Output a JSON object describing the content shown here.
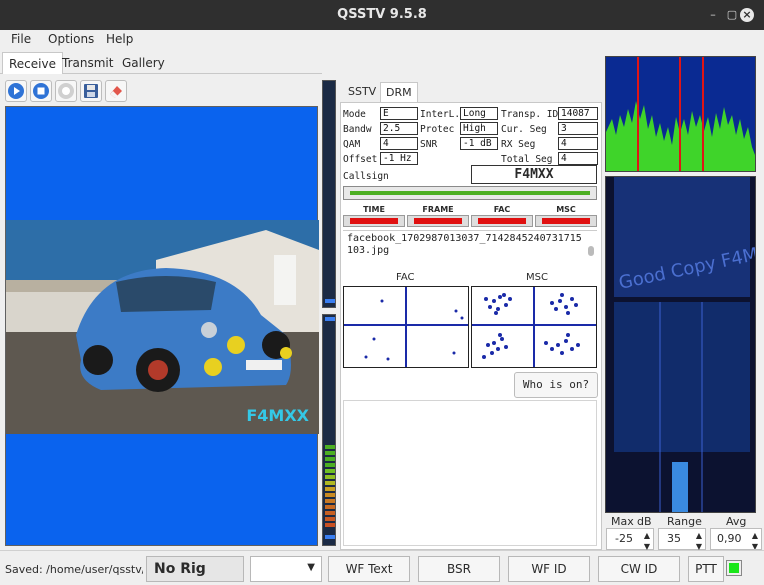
{
  "window": {
    "title": "QSSTV 9.5.8"
  },
  "menu": {
    "items": [
      "File",
      "Options",
      "Help"
    ]
  },
  "tabs": [
    "Receive",
    "Transmit",
    "Gallery"
  ],
  "toolbar": {
    "icons": [
      "start-icon",
      "stop-icon",
      "erase-icon",
      "save-icon",
      "eraser-icon"
    ]
  },
  "image": {
    "callsign_overlay": "F4MXX"
  },
  "mode_tabs": [
    "SSTV",
    "DRM"
  ],
  "drm": {
    "mode_label": "Mode",
    "mode_value": "E",
    "interl_label": "InterL.",
    "interl_value": "Long",
    "transp_label": "Transp. ID",
    "transp_value": "14087",
    "bandw_label": "Bandw",
    "bandw_value": "2.5",
    "protec_label": "Protec",
    "protec_value": "High",
    "curseg_label": "Cur. Seg",
    "curseg_value": "3",
    "qam_label": "QAM",
    "qam_value": "4",
    "snr_label": "SNR",
    "snr_value": "-1 dB",
    "rxseg_label": "RX  Seg",
    "rxseg_value": "4",
    "offset_label": "Offset",
    "offset_value": "-1 Hz",
    "totalseg_label": "Total Seg",
    "totalseg_value": "4",
    "callsign_label": "Callsign",
    "callsign_value": "F4MXX",
    "indicators": [
      "TIME",
      "FRAME",
      "FAC",
      "MSC"
    ],
    "filename": "facebook_1702987013037_7142845240731715103.jpg",
    "fac_label": "FAC",
    "msc_label": "MSC",
    "who_button": "Who is on?"
  },
  "waterfall": {
    "max_label": "Max",
    "db_label": "dB",
    "range_label": "Range",
    "avg_label": "Avg",
    "max_value": "-25",
    "range_value": "35",
    "avg_value": "0,90"
  },
  "status": {
    "saved_text": "Saved: /home/user/qsstv/rx",
    "rig": "No Rig",
    "buttons": [
      "WF Text",
      "BSR",
      "WF ID",
      "CW ID"
    ],
    "ptt": "PTT",
    "ptt_color": "#19e619"
  },
  "colors": {
    "accent_blue": "#0a63ee",
    "indicator_red": "#e01010",
    "level_green": "#4caf22"
  }
}
